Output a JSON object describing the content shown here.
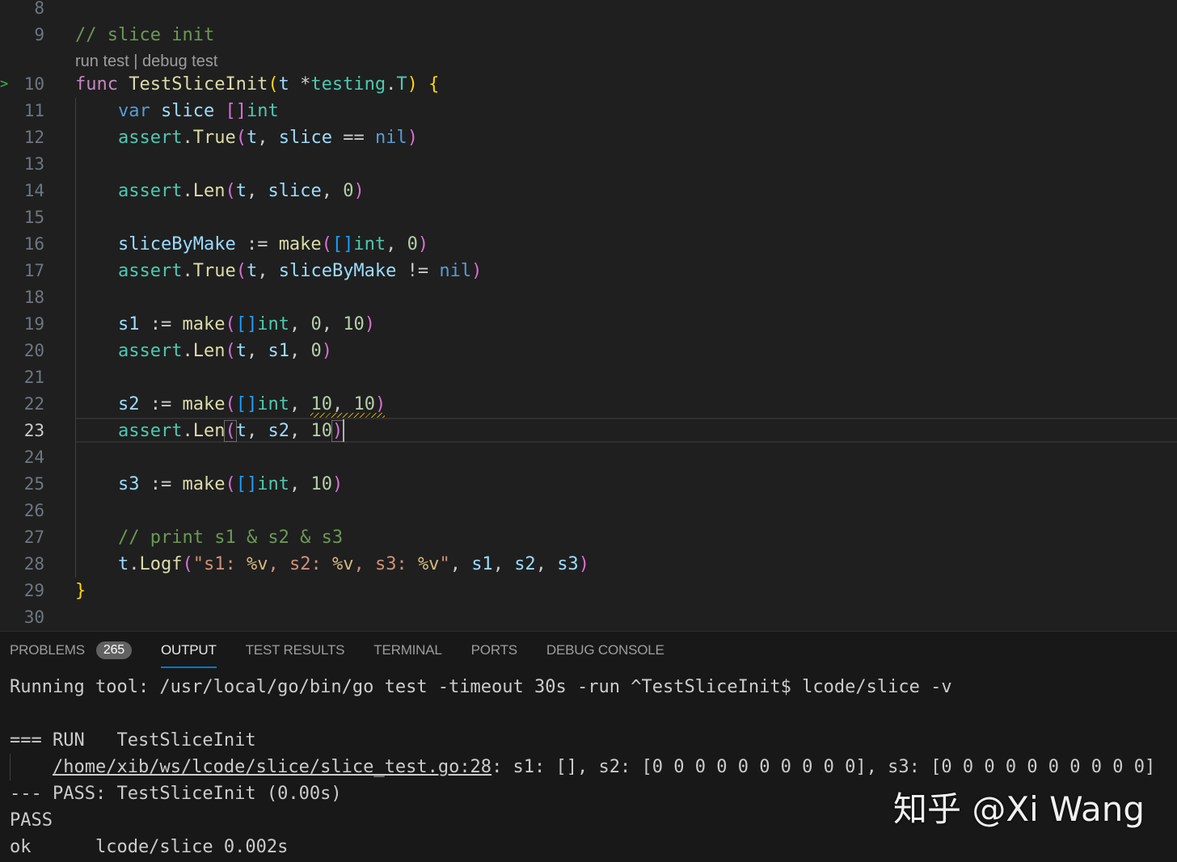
{
  "editor": {
    "codelens": "run test | debug test",
    "current_line": 23,
    "lines": [
      {
        "n": "8"
      },
      {
        "n": "9",
        "text": "// slice init"
      },
      {
        "n": "10",
        "t": [
          "func",
          " ",
          "TestSliceInit",
          "(",
          "t",
          " *",
          "testing",
          ".",
          "T",
          ")",
          " ",
          "{"
        ]
      },
      {
        "n": "11",
        "t": [
          "var",
          " ",
          "slice",
          " ",
          "[]",
          "int"
        ]
      },
      {
        "n": "12",
        "t": [
          "assert",
          ".",
          "True",
          "(",
          "t",
          ", ",
          "slice",
          " == ",
          "nil",
          ")"
        ]
      },
      {
        "n": "13"
      },
      {
        "n": "14",
        "t": [
          "assert",
          ".",
          "Len",
          "(",
          "t",
          ", ",
          "slice",
          ", ",
          "0",
          ")"
        ]
      },
      {
        "n": "15"
      },
      {
        "n": "16",
        "t": [
          "sliceByMake",
          " := ",
          "make",
          "(",
          "[]",
          "int",
          ", ",
          "0",
          ")"
        ]
      },
      {
        "n": "17",
        "t": [
          "assert",
          ".",
          "True",
          "(",
          "t",
          ", ",
          "sliceByMake",
          " != ",
          "nil",
          ")"
        ]
      },
      {
        "n": "18"
      },
      {
        "n": "19",
        "t": [
          "s1",
          " := ",
          "make",
          "(",
          "[]",
          "int",
          ", ",
          "0",
          ", ",
          "10",
          ")"
        ]
      },
      {
        "n": "20",
        "t": [
          "assert",
          ".",
          "Len",
          "(",
          "t",
          ", ",
          "s1",
          ", ",
          "0",
          ")"
        ]
      },
      {
        "n": "21"
      },
      {
        "n": "22",
        "t": [
          "s2",
          " := ",
          "make",
          "(",
          "[]",
          "int",
          ", ",
          "10",
          ", ",
          "10",
          ")"
        ]
      },
      {
        "n": "23",
        "t": [
          "assert",
          ".",
          "Len",
          "(",
          "t",
          ", ",
          "s2",
          ", ",
          "10",
          ")"
        ]
      },
      {
        "n": "24"
      },
      {
        "n": "25",
        "t": [
          "s3",
          " := ",
          "make",
          "(",
          "[]",
          "int",
          ", ",
          "10",
          ")"
        ]
      },
      {
        "n": "26"
      },
      {
        "n": "27",
        "text": "// print s1 & s2 & s3"
      },
      {
        "n": "28",
        "t": [
          "t",
          ".",
          "Logf",
          "(",
          "\"s1: ",
          "%v",
          ", s2: ",
          "%v",
          ", s3: ",
          "%v",
          "\"",
          ", ",
          "s1",
          ", ",
          "s2",
          ", ",
          "s3",
          ")"
        ]
      },
      {
        "n": "29",
        "t": [
          "}"
        ]
      },
      {
        "n": "30"
      }
    ]
  },
  "panel": {
    "tabs": [
      {
        "label": "PROBLEMS",
        "badge": "265"
      },
      {
        "label": "OUTPUT",
        "active": true
      },
      {
        "label": "TEST RESULTS"
      },
      {
        "label": "TERMINAL"
      },
      {
        "label": "PORTS"
      },
      {
        "label": "DEBUG CONSOLE"
      }
    ],
    "output": {
      "line1": "Running tool: /usr/local/go/bin/go test -timeout 30s -run ^TestSliceInit$ lcode/slice -v",
      "run_line": "=== RUN   TestSliceInit",
      "log_link": "/home/xib/ws/lcode/slice/slice_test.go:28",
      "log_rest": ": s1: [], s2: [0 0 0 0 0 0 0 0 0 0], s3: [0 0 0 0 0 0 0 0 0 0]",
      "pass_line": "--- PASS: TestSliceInit (0.00s)",
      "pass": "PASS",
      "ok_line": "ok      lcode/slice 0.002s"
    }
  },
  "watermark": "知乎 @Xi Wang",
  "colors": {
    "accent": "#0078d4",
    "background": "#1f1f1f",
    "panel": "#181818"
  }
}
